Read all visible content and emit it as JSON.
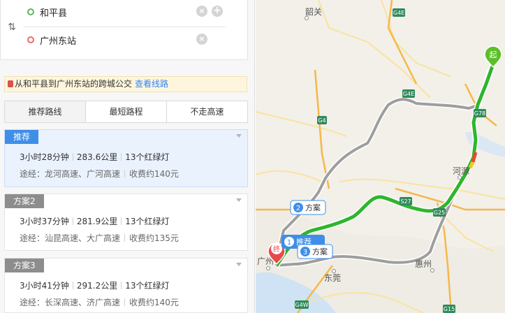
{
  "route": {
    "start": "和平县",
    "end": "广州东站",
    "swap_icon": "swap-arrows-icon",
    "clear_icon": "close-circle-icon",
    "add_icon": "plus-circle-icon"
  },
  "notice": {
    "text": "从和平县到广州东站的跨城公交",
    "link": "查看线路",
    "icon": "bus-icon"
  },
  "tabs": [
    "推荐路线",
    "最短路程",
    "不走高速"
  ],
  "plans": [
    {
      "tag": "推荐",
      "time": "3小时28分钟",
      "distance": "283.6公里",
      "lights": "13个红绿灯",
      "via": "途经：龙河高速、广河高速",
      "toll": "收费约140元"
    },
    {
      "tag": "方案2",
      "time": "3小时37分钟",
      "distance": "281.9公里",
      "lights": "13个红绿灯",
      "via": "途经：汕昆高速、大广高速",
      "toll": "收费约135元"
    },
    {
      "tag": "方案3",
      "time": "3小时41分钟",
      "distance": "291.2公里",
      "lights": "13个红绿灯",
      "via": "途经：长深高速、济广高速",
      "toll": "收费约140元"
    }
  ],
  "map": {
    "cities": [
      "韶关",
      "河源",
      "惠州",
      "东莞",
      "广州"
    ],
    "highways": [
      "G4E",
      "G4E",
      "G4",
      "G78",
      "S27",
      "G25",
      "G4W",
      "G15"
    ],
    "start_marker": "起",
    "end_marker": "终",
    "route_labels": [
      {
        "num": "1",
        "text": "推荐"
      },
      {
        "num": "2",
        "text": "方案"
      },
      {
        "num": "3",
        "text": "方案"
      }
    ],
    "colors": {
      "primary_route": "#2fb52f",
      "alt_route": "#9e9e9e",
      "accent": "#3f8ee8"
    }
  }
}
